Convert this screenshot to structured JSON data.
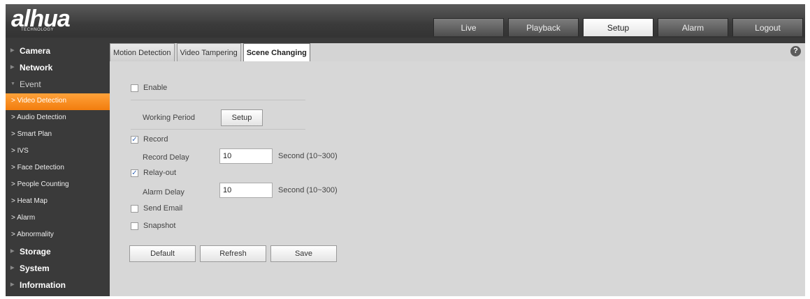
{
  "brand": {
    "logo": "alhua",
    "subtitle": "TECHNOLOGY"
  },
  "topnav": [
    {
      "label": "Live",
      "active": false
    },
    {
      "label": "Playback",
      "active": false
    },
    {
      "label": "Setup",
      "active": true
    },
    {
      "label": "Alarm",
      "active": false
    },
    {
      "label": "Logout",
      "active": false
    }
  ],
  "sidebar": {
    "camera": "Camera",
    "network": "Network",
    "event": "Event",
    "subitems": [
      "> Video Detection",
      "> Audio Detection",
      "> Smart Plan",
      "> IVS",
      "> Face Detection",
      "> People Counting",
      "> Heat Map",
      "> Alarm",
      "> Abnormality"
    ],
    "storage": "Storage",
    "system": "System",
    "information": "Information"
  },
  "tabs": [
    {
      "label": "Motion Detection",
      "active": false
    },
    {
      "label": "Video Tampering",
      "active": false
    },
    {
      "label": "Scene Changing",
      "active": true
    }
  ],
  "help_icon": "?",
  "form": {
    "enable": {
      "label": "Enable",
      "checked": false
    },
    "working_period": {
      "label": "Working Period",
      "button": "Setup"
    },
    "record": {
      "label": "Record",
      "checked": true
    },
    "record_delay": {
      "label": "Record Delay",
      "value": "10",
      "unit": "Second (10~300)"
    },
    "relay_out": {
      "label": "Relay-out",
      "checked": true
    },
    "alarm_delay": {
      "label": "Alarm Delay",
      "value": "10",
      "unit": "Second (10~300)"
    },
    "send_email": {
      "label": "Send Email",
      "checked": false
    },
    "snapshot": {
      "label": "Snapshot",
      "checked": false
    }
  },
  "buttons": {
    "default": "Default",
    "refresh": "Refresh",
    "save": "Save"
  },
  "check_glyph": "✓",
  "colors": {
    "active_menu": "#f58a1f",
    "header": "#3b3b3b",
    "panel": "#d7d7d7"
  }
}
